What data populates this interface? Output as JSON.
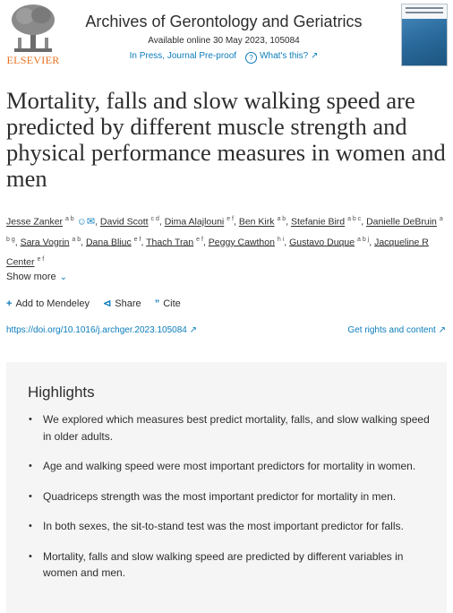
{
  "header": {
    "publisher": "ELSEVIER",
    "journal": "Archives of Gerontology and Geriatrics",
    "available": "Available online 30 May 2023, 105084",
    "status": "In Press, Journal Pre-proof",
    "whats_this": "What's this?"
  },
  "article": {
    "title": "Mortality, falls and slow walking speed are predicted by different muscle strength and physical performance measures in women and men",
    "authors": [
      {
        "name": "Jesse Zanker",
        "sup": "a b"
      },
      {
        "name": "David Scott",
        "sup": "c d"
      },
      {
        "name": "Dima Alajlouni",
        "sup": "e f"
      },
      {
        "name": "Ben Kirk",
        "sup": "a b"
      },
      {
        "name": "Stefanie Bird",
        "sup": "a b c"
      },
      {
        "name": "Danielle DeBruin",
        "sup": "a b g"
      },
      {
        "name": "Sara Vogrin",
        "sup": "a b"
      },
      {
        "name": "Dana Bliuc",
        "sup": "e f"
      },
      {
        "name": "Thach Tran",
        "sup": "e f"
      },
      {
        "name": "Peggy Cawthon",
        "sup": "h i"
      },
      {
        "name": "Gustavo Duque",
        "sup": "a b j"
      },
      {
        "name": "Jacqueline R Center",
        "sup": "e f"
      }
    ],
    "show_more": "Show more",
    "actions": {
      "mendeley": "Add to Mendeley",
      "share": "Share",
      "cite": "Cite"
    },
    "doi": "https://doi.org/10.1016/j.archger.2023.105084",
    "rights": "Get rights and content"
  },
  "highlights": {
    "title": "Highlights",
    "items": [
      "We explored which measures best predict mortality, falls, and slow walking speed in older adults.",
      "Age and walking speed were most important predictors for mortality in women.",
      "Quadriceps strength was the most important predictor for mortality in men.",
      "In both sexes, the sit-to-stand test was the most important predictor for falls.",
      "Mortality, falls and slow walking speed are predicted by different variables in women and men."
    ]
  },
  "colors": {
    "link": "#0c7dbb",
    "elsevier_orange": "#e9711c",
    "highlights_bg": "#f5f5f5"
  },
  "icons": {
    "person": "person-icon",
    "mail": "envelope-icon",
    "help": "question-circle-icon",
    "external": "external-link-icon"
  }
}
